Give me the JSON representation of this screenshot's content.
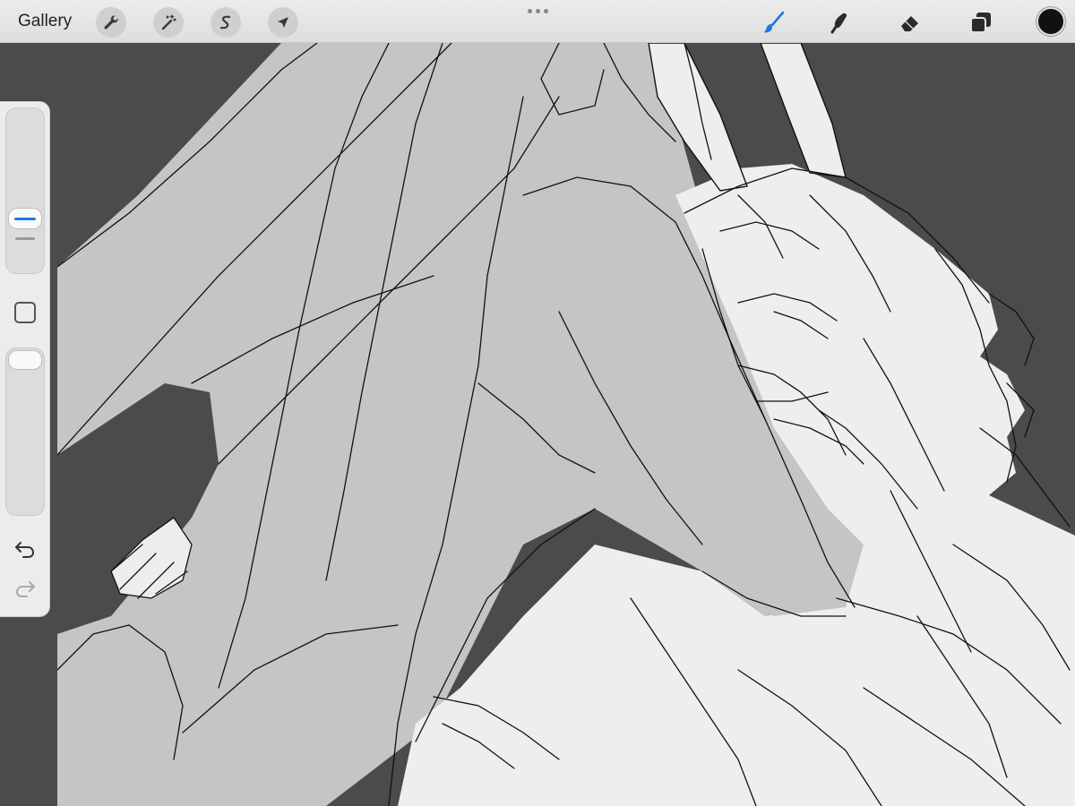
{
  "toolbar": {
    "gallery_label": "Gallery",
    "left_tools": [
      {
        "name": "actions",
        "icon": "wrench-icon"
      },
      {
        "name": "adjustments",
        "icon": "magic-wand-icon"
      },
      {
        "name": "selection",
        "icon": "selection-s-icon"
      },
      {
        "name": "transform",
        "icon": "arrow-cursor-icon"
      }
    ],
    "right_tools": [
      {
        "name": "brush",
        "icon": "brush-icon",
        "active": true
      },
      {
        "name": "smudge",
        "icon": "smudge-icon"
      },
      {
        "name": "eraser",
        "icon": "eraser-icon"
      },
      {
        "name": "layers",
        "icon": "layers-icon"
      }
    ],
    "active_color": "#111111",
    "accent_color": "#1f77e0"
  },
  "sidebar": {
    "brush_size_level": 0.3,
    "opacity_level": 1.0
  },
  "colors": {
    "background": "#4a4b4b",
    "figure_gray": "#c4c5c7",
    "figure_light": "#efeeed",
    "line": "#111111"
  }
}
